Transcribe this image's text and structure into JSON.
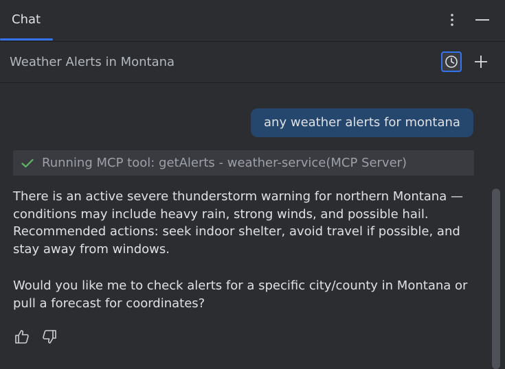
{
  "header": {
    "tab_label": "Chat",
    "options_icon": "vertical-ellipsis-icon",
    "minimize_icon": "minimize-icon"
  },
  "conversation": {
    "title": "Weather Alerts in Montana",
    "history_icon": "clock-icon",
    "new_chat_icon": "plus-icon"
  },
  "messages": {
    "user": "any weather alerts for montana",
    "tool_status": "Running MCP tool: getAlerts - weather-service(MCP Server)",
    "assistant_paragraph_1": "There is an active severe thunderstorm warning for northern Montana — conditions may include heavy rain, strong winds, and possible hail. Recommended actions: seek indoor shelter, avoid travel if possible, and stay away from windows.",
    "assistant_paragraph_2": "Would you like me to check alerts for a specific city/county in Montana or pull a forecast for coordinates?"
  },
  "feedback": {
    "like_icon": "thumbs-up-icon",
    "dislike_icon": "thumbs-down-icon"
  },
  "colors": {
    "background": "#2b2d30",
    "accent": "#3574f0",
    "user_bubble": "#26476d",
    "tool_row": "#393b40",
    "success": "#5fb865"
  }
}
